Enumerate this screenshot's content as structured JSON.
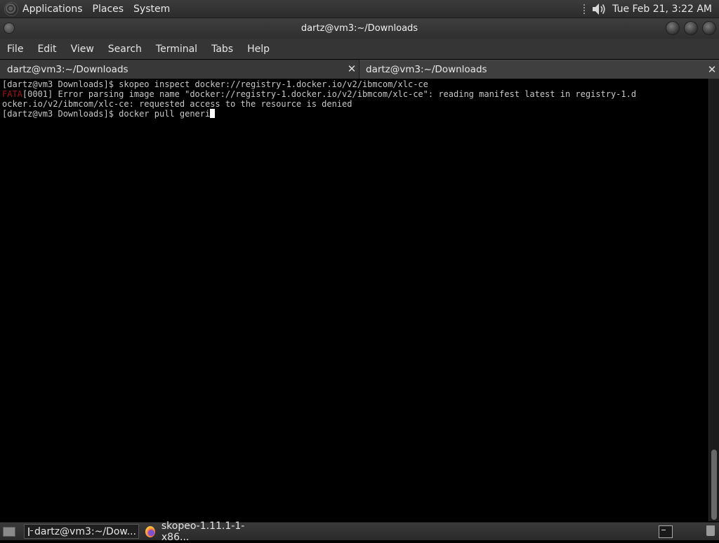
{
  "top_panel": {
    "menus": [
      "Applications",
      "Places",
      "System"
    ],
    "clock": "Tue Feb 21,  3:22 AM"
  },
  "window": {
    "title": "dartz@vm3:~/Downloads"
  },
  "menubar": {
    "items": [
      "File",
      "Edit",
      "View",
      "Search",
      "Terminal",
      "Tabs",
      "Help"
    ]
  },
  "tabs": [
    {
      "label": "dartz@vm3:~/Downloads",
      "active": false
    },
    {
      "label": "dartz@vm3:~/Downloads",
      "active": true
    }
  ],
  "terminal": {
    "line1": "[dartz@vm3 Downloads]$ skopeo inspect docker://registry-1.docker.io/v2/ibmcom/xlc-ce",
    "fatal_tag": "FATA",
    "line2_rest": "[0001] Error parsing image name \"docker://registry-1.docker.io/v2/ibmcom/xlc-ce\": reading manifest latest in registry-1.d",
    "line3": "ocker.io/v2/ibmcom/xlc-ce: requested access to the resource is denied",
    "prompt": "[dartz@vm3 Downloads]$ ",
    "current_input": "docker pull generi"
  },
  "colors": {
    "fatal": "#a0141a",
    "terminal_bg": "#000000",
    "terminal_fg": "#c8c8c8"
  },
  "taskbar": {
    "tasks": [
      {
        "label": "dartz@vm3:~/Dow...",
        "icon": "terminal-icon",
        "active": true
      },
      {
        "label": "skopeo-1.11.1-1-x86...",
        "icon": "firefox-icon",
        "active": false
      }
    ]
  }
}
